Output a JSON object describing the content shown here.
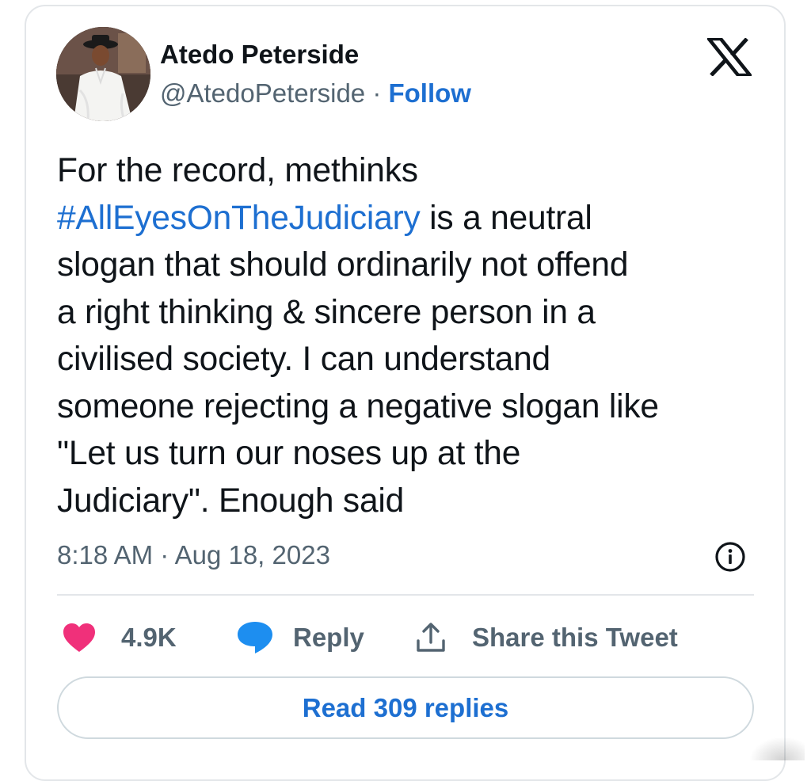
{
  "author": {
    "name": "Atedo Peterside",
    "handle": "@AtedoPeterside",
    "separator": " · ",
    "follow_label": "Follow",
    "avatar_icon": "profile-photo"
  },
  "platform_logo": "x-logo",
  "tweet": {
    "lines": [
      {
        "text": "For the record, methinks"
      },
      {
        "hashtag": "#AllEyesOnTheJudiciary",
        "text": " is a neutral"
      },
      {
        "text": "slogan that should ordinarily not offend"
      },
      {
        "text": "a right thinking & sincere person in a"
      },
      {
        "text": "civilised society. I can understand"
      },
      {
        "text": "someone rejecting a negative slogan like"
      },
      {
        "text": "\"Let us turn our noses up at the"
      },
      {
        "text": "Judiciary\". Enough said"
      }
    ]
  },
  "timestamp": "8:18 AM · Aug 18, 2023",
  "info_icon": "info-circle-icon",
  "actions": {
    "likes_count": "4.9K",
    "reply_label": "Reply",
    "share_label": "Share this Tweet"
  },
  "read_replies_label": "Read 309 replies",
  "colors": {
    "link_blue": "#1d6fd1",
    "heart_pink": "#f0307a",
    "reply_blue": "#1d8ef0",
    "text_dark": "#0f1419",
    "text_gray": "#536471"
  }
}
